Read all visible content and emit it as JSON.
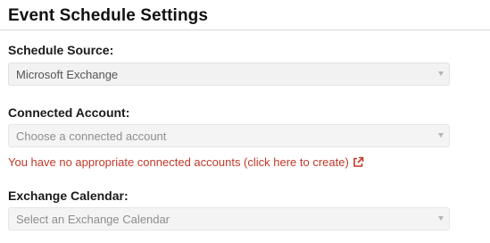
{
  "page": {
    "title": "Event Schedule Settings"
  },
  "schedule_source": {
    "label": "Schedule Source:",
    "value": "Microsoft Exchange"
  },
  "connected_account": {
    "label": "Connected Account:",
    "placeholder": "Choose a connected account",
    "warning_link": "You have no appropriate connected accounts (click here to create)"
  },
  "exchange_calendar": {
    "label": "Exchange Calendar:",
    "placeholder": "Select an Exchange Calendar"
  },
  "icons": {
    "caret": "chevron-down-icon",
    "external_link": "external-link-icon"
  },
  "colors": {
    "warning_text": "#c0392b",
    "select_background": "#f2f2f2"
  }
}
